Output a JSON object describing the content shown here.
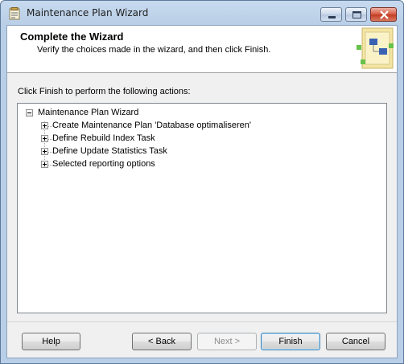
{
  "window": {
    "title": "Maintenance Plan Wizard"
  },
  "header": {
    "title": "Complete the Wizard",
    "subtitle": "Verify the choices made in the wizard, and then click Finish."
  },
  "instruction": "Click Finish to perform the following actions:",
  "tree": {
    "root": {
      "label": "Maintenance Plan Wizard",
      "expanded": true
    },
    "children": [
      {
        "label": "Create Maintenance Plan 'Database optimaliseren'",
        "expanded": false
      },
      {
        "label": "Define Rebuild Index Task",
        "expanded": false
      },
      {
        "label": "Define Update Statistics Task",
        "expanded": false
      },
      {
        "label": "Selected reporting options",
        "expanded": false
      }
    ]
  },
  "buttons": {
    "help": "Help",
    "back": "< Back",
    "next": "Next >",
    "finish": "Finish",
    "cancel": "Cancel"
  }
}
